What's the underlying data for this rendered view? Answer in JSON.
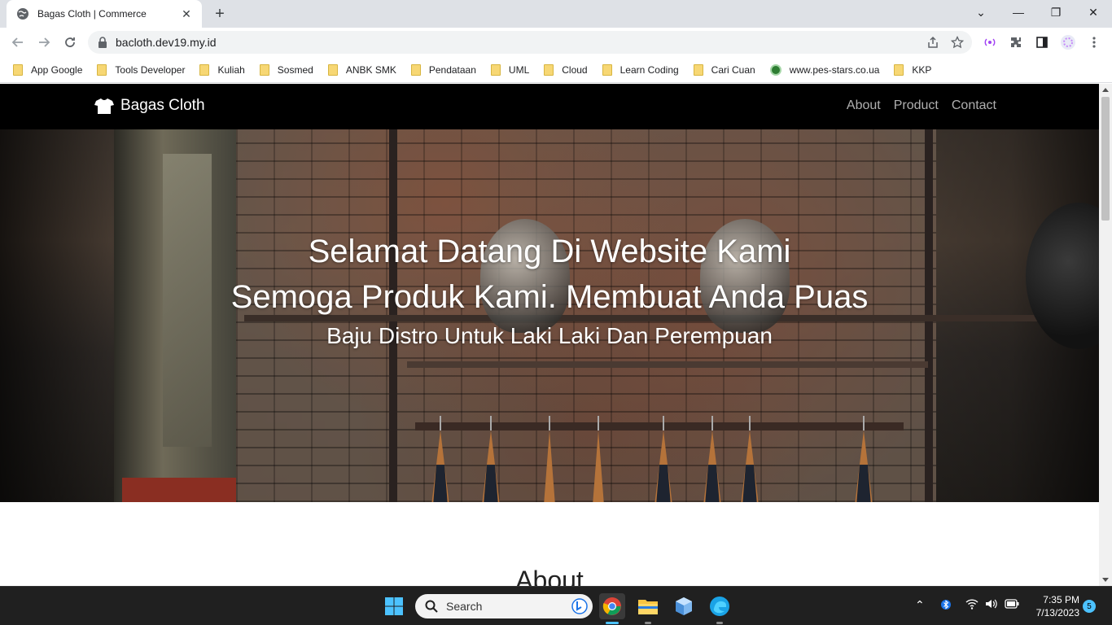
{
  "browser": {
    "tab_title": "Bagas Cloth | Commerce",
    "url": "bacloth.dev19.my.id"
  },
  "bookmarks": [
    {
      "label": "App Google",
      "type": "folder"
    },
    {
      "label": "Tools Developer",
      "type": "folder"
    },
    {
      "label": "Kuliah",
      "type": "folder"
    },
    {
      "label": "Sosmed",
      "type": "folder"
    },
    {
      "label": "ANBK SMK",
      "type": "folder"
    },
    {
      "label": "Pendataan",
      "type": "folder"
    },
    {
      "label": "UML",
      "type": "folder"
    },
    {
      "label": "Cloud",
      "type": "folder"
    },
    {
      "label": "Learn Coding",
      "type": "folder"
    },
    {
      "label": "Cari Cuan",
      "type": "folder"
    },
    {
      "label": "www.pes-stars.co.ua",
      "type": "site"
    },
    {
      "label": "KKP",
      "type": "folder"
    }
  ],
  "site": {
    "brand": "Bagas Cloth",
    "nav": [
      "About",
      "Product",
      "Contact"
    ],
    "hero_line1": "Selamat Datang Di Website Kami",
    "hero_line2": "Semoga Produk Kami. Membuat Anda Puas",
    "hero_line3": "Baju Distro Untuk Laki Laki Dan Perempuan",
    "section_title": "About"
  },
  "taskbar": {
    "search_label": "Search",
    "time": "7:35 PM",
    "date": "7/13/2023",
    "notification_count": "5"
  },
  "colors": {
    "site_nav_bg": "#000000",
    "nav_link": "#b0b0b0",
    "taskbar_bg": "#202020"
  }
}
